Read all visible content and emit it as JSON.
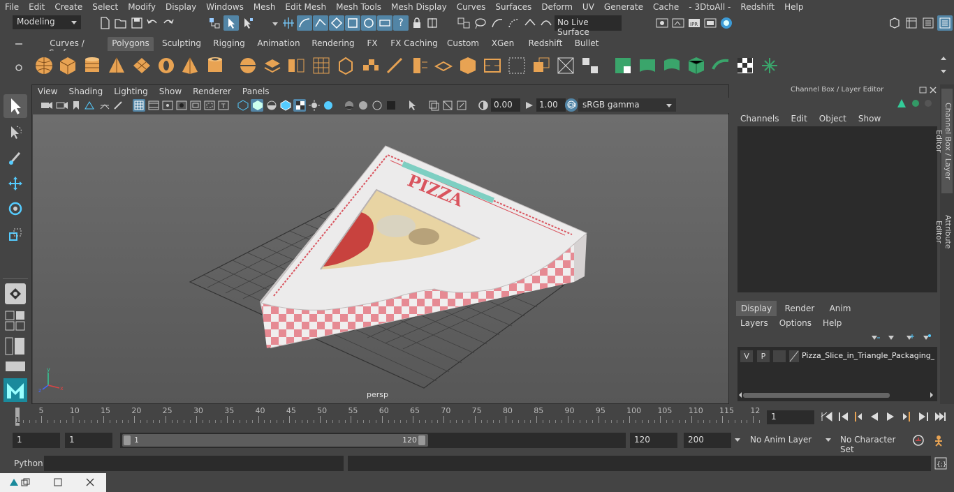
{
  "menubar": [
    "File",
    "Edit",
    "Create",
    "Select",
    "Modify",
    "Display",
    "Windows",
    "Mesh",
    "Edit Mesh",
    "Mesh Tools",
    "Mesh Display",
    "Curves",
    "Surfaces",
    "Deform",
    "UV",
    "Generate",
    "Cache",
    "- 3DtoAll -",
    "Redshift",
    "Help"
  ],
  "statusline": {
    "mode": "Modeling",
    "live_surface": "No Live Surface"
  },
  "shelf_tabs": [
    "Curves / Surfaces",
    "Polygons",
    "Sculpting",
    "Rigging",
    "Animation",
    "Rendering",
    "FX",
    "FX Caching",
    "Custom",
    "XGen",
    "Redshift",
    "Bullet"
  ],
  "shelf_active": "Polygons",
  "panel_menu": [
    "View",
    "Shading",
    "Lighting",
    "Show",
    "Renderer",
    "Panels"
  ],
  "panel_toolbar": {
    "exposure": "0.00",
    "gamma": "1.00",
    "colorspace": "sRGB gamma"
  },
  "viewport": {
    "camera_label": "persp",
    "box_label": "PIZZA",
    "accent": "#d9545e"
  },
  "channel_box": {
    "title": "Channel Box / Layer Editor",
    "menu": [
      "Channels",
      "Edit",
      "Object",
      "Show"
    ]
  },
  "layer_editor": {
    "tabs": [
      "Display",
      "Render",
      "Anim"
    ],
    "active_tab": "Display",
    "menu": [
      "Layers",
      "Options",
      "Help"
    ],
    "layer": {
      "v": "V",
      "p": "P",
      "name": "Pizza_Slice_in_Triangle_Packaging_Bo"
    }
  },
  "side_tabs": [
    "Channel Box / Layer Editor",
    "Attribute Editor"
  ],
  "timeline": {
    "ticks": [
      "5",
      "10",
      "15",
      "20",
      "25",
      "30",
      "35",
      "40",
      "45",
      "50",
      "55",
      "60",
      "65",
      "70",
      "75",
      "80",
      "85",
      "90",
      "95",
      "100",
      "105",
      "110",
      "115",
      "12"
    ],
    "first": "1",
    "current_frame": "1"
  },
  "range": {
    "start": "1",
    "anim_start": "1",
    "slider_start": "1",
    "slider_end": "120",
    "end": "120",
    "anim_end": "200",
    "anim_layer": "No Anim Layer",
    "char_set": "No Character Set"
  },
  "cmdline": {
    "label": "Python"
  }
}
